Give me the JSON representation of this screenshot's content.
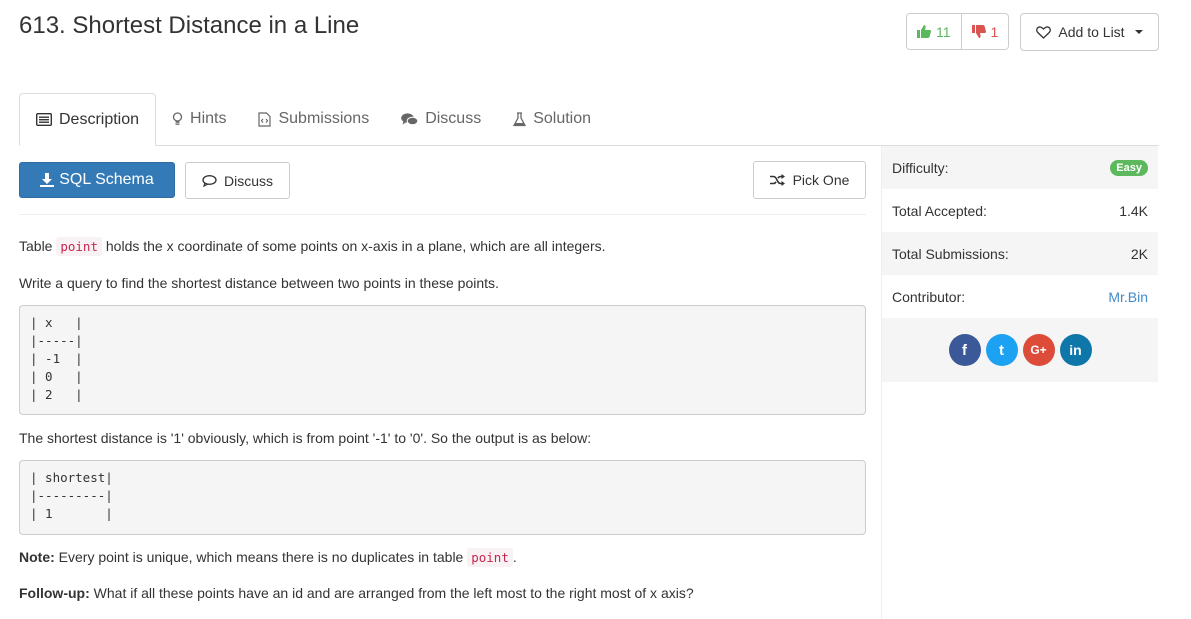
{
  "problem": {
    "title": "613. Shortest Distance in a Line"
  },
  "votes": {
    "up": "11",
    "down": "1"
  },
  "add_list": {
    "label": "Add to List"
  },
  "tabs": [
    {
      "label": "Description",
      "icon": "list-icon"
    },
    {
      "label": "Hints",
      "icon": "bulb-icon"
    },
    {
      "label": "Submissions",
      "icon": "code-file-icon"
    },
    {
      "label": "Discuss",
      "icon": "comments-icon"
    },
    {
      "label": "Solution",
      "icon": "flask-icon"
    }
  ],
  "toolbar": {
    "schema": "SQL Schema",
    "discuss": "Discuss",
    "pick": "Pick One"
  },
  "description": {
    "p1_before": "Table ",
    "p1_code": "point",
    "p1_after": " holds the x coordinate of some points on x-axis in a plane, which are all integers.",
    "p2": "Write a query to find the shortest distance between two points in these points.",
    "table1": "| x   |\n|-----|\n| -1  |\n| 0   |\n| 2   |",
    "p3": "The shortest distance is '1' obviously, which is from point '-1' to '0'. So the output is as below:",
    "table2": "| shortest|\n|---------|\n| 1       |",
    "note_label": "Note:",
    "note_text": " Every point is unique, which means there is no duplicates in table ",
    "note_code": "point",
    "note_end": ".",
    "follow_label": "Follow-up:",
    "follow_text": " What if all these points have an id and are arranged from the left most to the right most of x axis?"
  },
  "sidebar": {
    "difficulty_label": "Difficulty:",
    "difficulty_value": "Easy",
    "accepted_label": "Total Accepted:",
    "accepted_value": "1.4K",
    "submissions_label": "Total Submissions:",
    "submissions_value": "2K",
    "contributor_label": "Contributor:",
    "contributor_value": "Mr.Bin"
  },
  "social": [
    {
      "name": "facebook-icon",
      "glyph": "f",
      "color": "#3b5998"
    },
    {
      "name": "twitter-icon",
      "glyph": "t",
      "color": "#1da1f2"
    },
    {
      "name": "google-plus-icon",
      "glyph": "G+",
      "color": "#dd4b39"
    },
    {
      "name": "linkedin-icon",
      "glyph": "in",
      "color": "#0e76a8"
    }
  ]
}
